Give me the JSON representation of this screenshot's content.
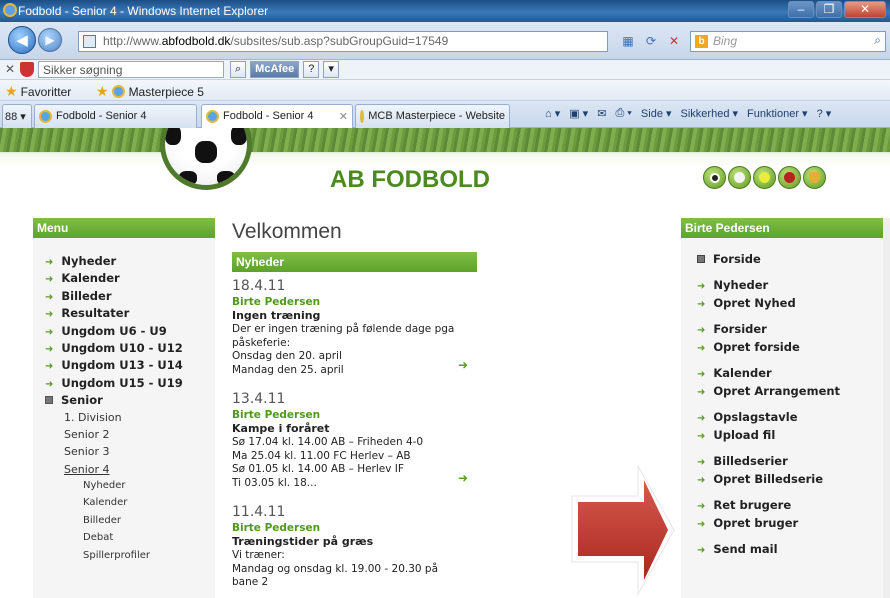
{
  "window": {
    "title": "Fodbold - Senior 4 - Windows Internet Explorer",
    "btn_min": "–",
    "btn_max": "❐",
    "btn_close": "✕"
  },
  "address": {
    "url_prefix": "http://www.",
    "url_domain": "abfodbold.dk",
    "url_path": "/subsites/sub.asp?subGroupGuid=17549",
    "search_placeholder": "Bing",
    "bing_icon": "b",
    "search_icon": "⌕"
  },
  "mcafee": {
    "close": "✕",
    "search_placeholder": "Sikker søgning",
    "search_btn": "⌕",
    "brand": "McAfee",
    "help": "?",
    "settings": "▾"
  },
  "favorites": {
    "label": "Favoritter",
    "item1": "Masterpiece 5"
  },
  "tabs": {
    "quick": "88 ▾",
    "tab1": "Fodbold - Senior 4",
    "tab2": "Fodbold - Senior 4",
    "tab2_close": "✕",
    "tab3": "MCB Masterpiece - Website",
    "tools": [
      "⌂ ▾",
      "▣ ▾",
      "✉",
      "⎙ ▾",
      "Side ▾",
      "Sikkerhed ▾",
      "Funktioner ▾",
      "? ▾"
    ]
  },
  "site": {
    "title": "AB FODBOLD"
  },
  "menu": {
    "heading": "Menu",
    "items": [
      "Nyheder",
      "Kalender",
      "Billeder",
      "Resultater",
      "Ungdom U6 - U9",
      "Ungdom U10 - U12",
      "Ungdom U13 - U14",
      "Ungdom U15 - U19"
    ],
    "expanded": "Senior",
    "sub": [
      "1. Division",
      "Senior 2",
      "Senior 3",
      "Senior 4"
    ],
    "sub2": [
      "Nyheder",
      "Kalender",
      "Billeder",
      "Debat",
      "Spillerprofiler"
    ]
  },
  "main": {
    "heading": "Velkommen",
    "news_heading": "Nyheder",
    "news": [
      {
        "date": "18.4.11",
        "author": "Birte Pedersen",
        "headline": "Ingen træning",
        "body": [
          "Der er ingen træning på følende dage pga",
          "påskeferie:",
          "Onsdag den 20. april",
          "Mandag den 25. april"
        ]
      },
      {
        "date": "13.4.11",
        "author": "Birte Pedersen",
        "headline": "Kampe i foråret",
        "body": [
          "Sø 17.04 kl. 14.00 AB – Friheden 4-0",
          "Ma 25.04 kl. 11.00 FC Herlev – AB",
          "Sø 01.05 kl. 14.00 AB – Herlev IF",
          "Ti 03.05 kl. 18..."
        ]
      },
      {
        "date": "11.4.11",
        "author": "Birte Pedersen",
        "headline": "Træningstider på græs",
        "body": [
          "Vi træner:",
          "Mandag og onsdag kl. 19.00 - 20.30 på",
          "bane 2"
        ]
      }
    ],
    "more_arrow": "➜"
  },
  "profile": {
    "heading": "Birte Pedersen",
    "top": "Forside",
    "groups": [
      [
        "Nyheder",
        "Opret Nyhed"
      ],
      [
        "Forsider",
        "Opret forside"
      ],
      [
        "Kalender",
        "Opret Arrangement"
      ],
      [
        "Opslagstavle",
        "Upload fil"
      ],
      [
        "Billedserier",
        "Opret Billedserie"
      ],
      [
        "Ret brugere",
        "Opret bruger"
      ],
      [
        "Send mail"
      ]
    ]
  },
  "colors": {
    "accent_green": "#5da22a",
    "annotation_arrow": "#c0392b"
  }
}
